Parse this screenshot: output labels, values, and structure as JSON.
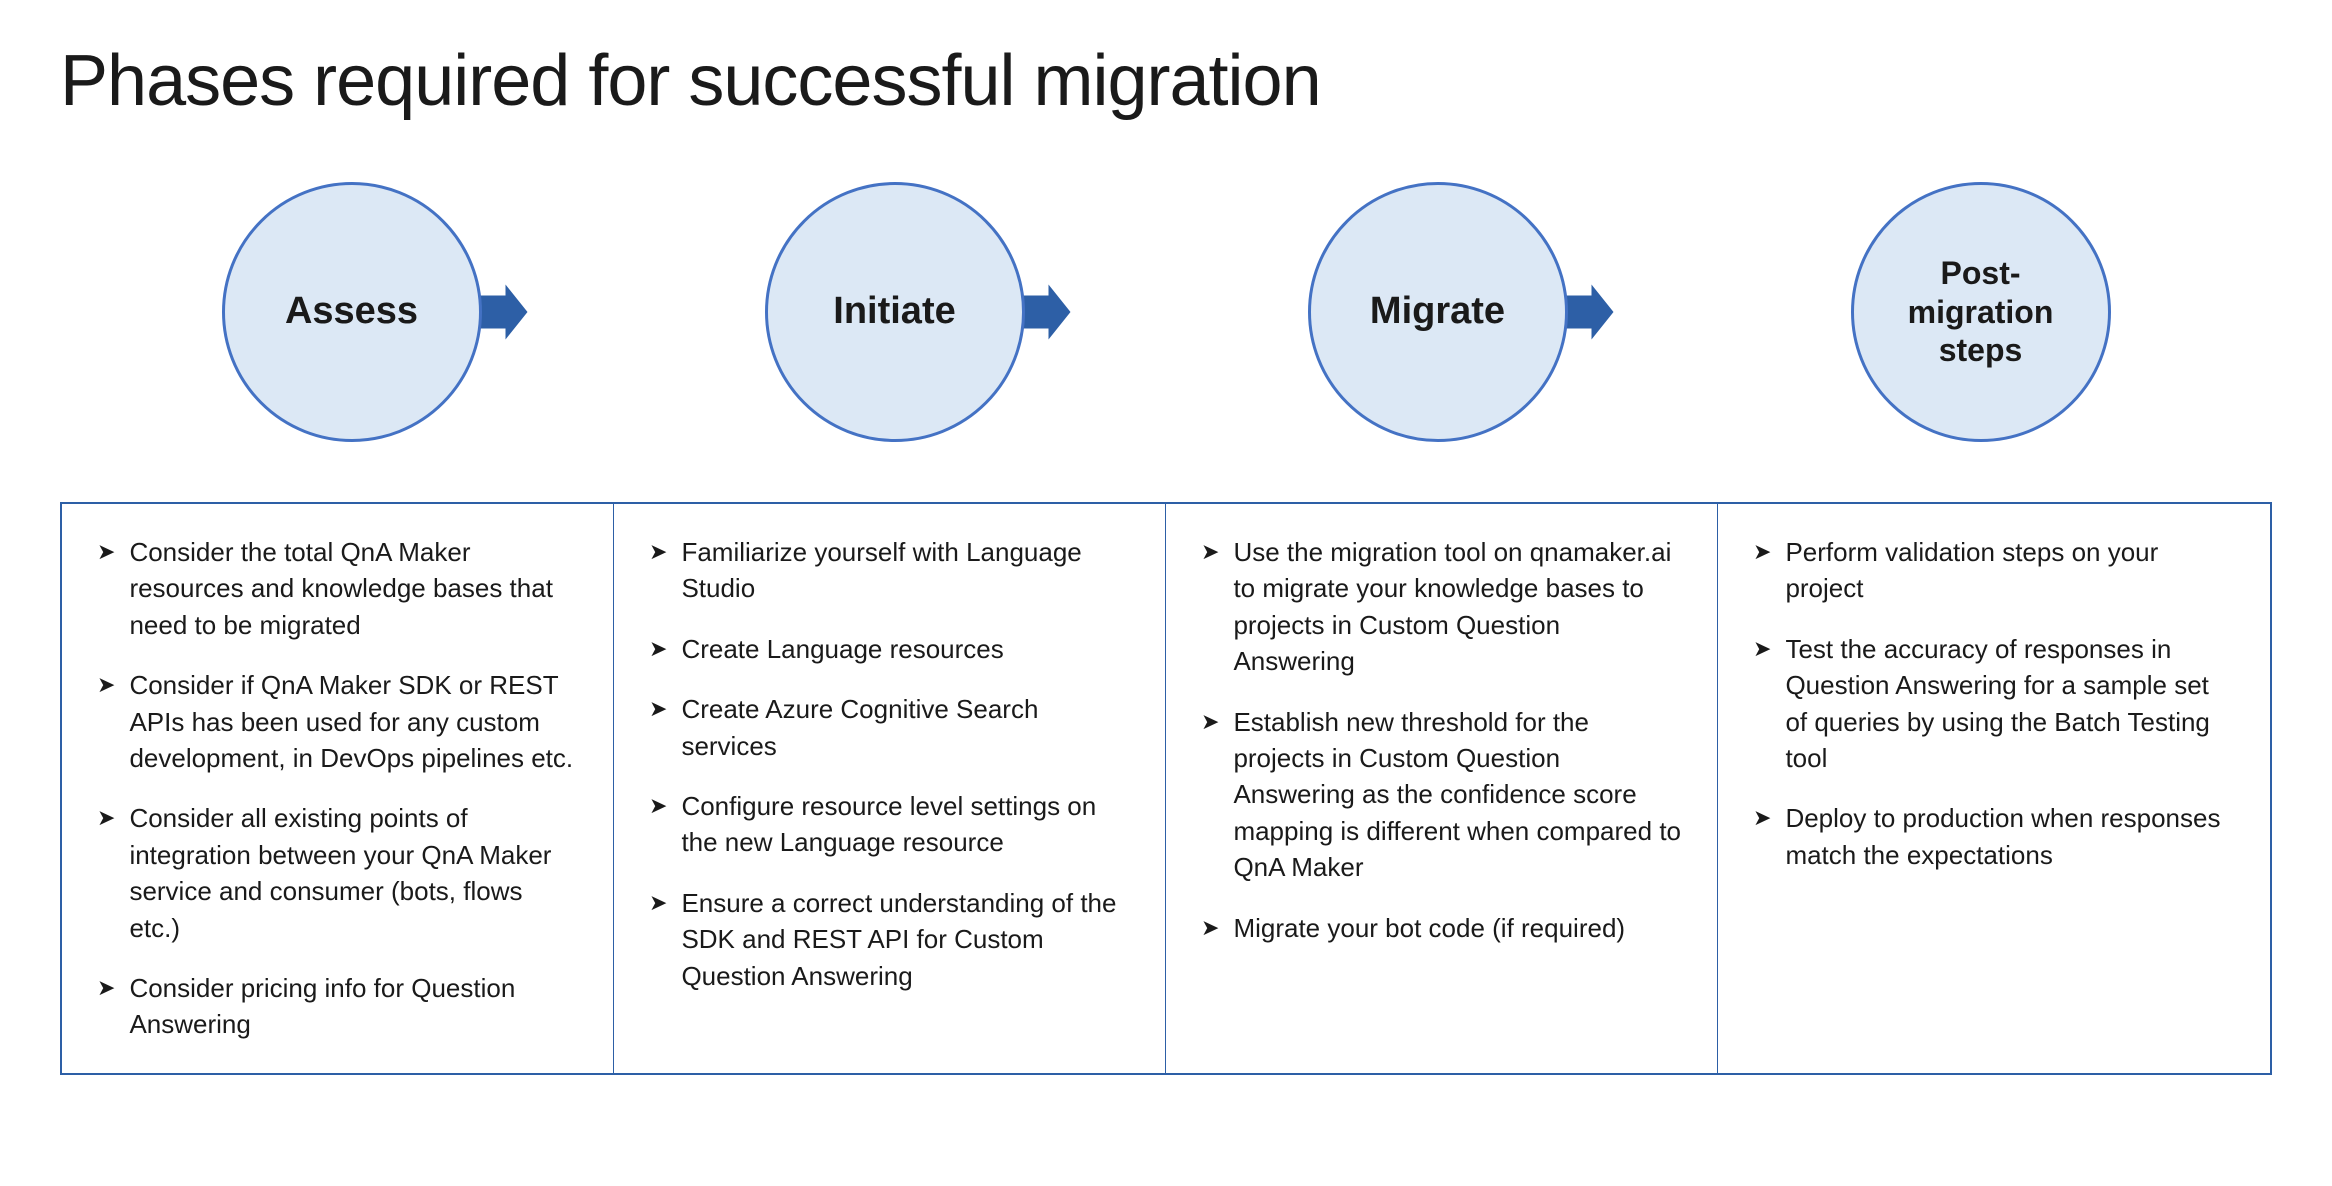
{
  "title": "Phases required for successful migration",
  "phases": [
    {
      "id": "assess",
      "label": "Assess"
    },
    {
      "id": "initiate",
      "label": "Initiate"
    },
    {
      "id": "migrate",
      "label": "Migrate"
    },
    {
      "id": "post-migration",
      "label": "Post-\nmigration\nsteps",
      "multiline": true
    }
  ],
  "columns": [
    {
      "id": "assess-col",
      "bullets": [
        "Consider the total QnA Maker resources and knowledge bases that need to be migrated",
        "Consider if QnA Maker SDK or REST APIs has been used for any custom development, in DevOps pipelines etc.",
        "Consider all existing points of integration between your QnA Maker service and consumer (bots, flows etc.)",
        "Consider pricing info for Question Answering"
      ]
    },
    {
      "id": "initiate-col",
      "bullets": [
        "Familiarize yourself with Language Studio",
        "Create Language resources",
        "Create Azure Cognitive Search services",
        "Configure resource level settings on the new Language resource",
        "Ensure a correct understanding of the SDK and REST API for Custom Question Answering"
      ]
    },
    {
      "id": "migrate-col",
      "bullets": [
        "Use the migration tool on qnamaker.ai to migrate your knowledge bases to projects in Custom Question Answering",
        "Establish new threshold for the projects in Custom Question Answering as the confidence score mapping is different when compared to QnA Maker",
        "Migrate your bot code (if required)"
      ]
    },
    {
      "id": "post-migration-col",
      "bullets": [
        "Perform validation steps on your project",
        "Test the accuracy of responses in Question Answering for a sample set of queries by using the Batch Testing tool",
        "Deploy to production when responses match the expectations"
      ]
    }
  ],
  "bullet_symbol": "➤"
}
